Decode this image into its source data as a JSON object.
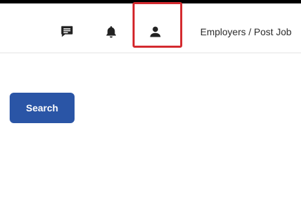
{
  "header": {
    "icons": {
      "messages": "chat-bubble-icon",
      "notifications": "bell-icon",
      "profile": "user-icon"
    },
    "employers_link": "Employers / Post Job",
    "highlight_color": "#d42a2f"
  },
  "main": {
    "search_button_label": "Search",
    "search_button_color": "#2a55a6"
  }
}
